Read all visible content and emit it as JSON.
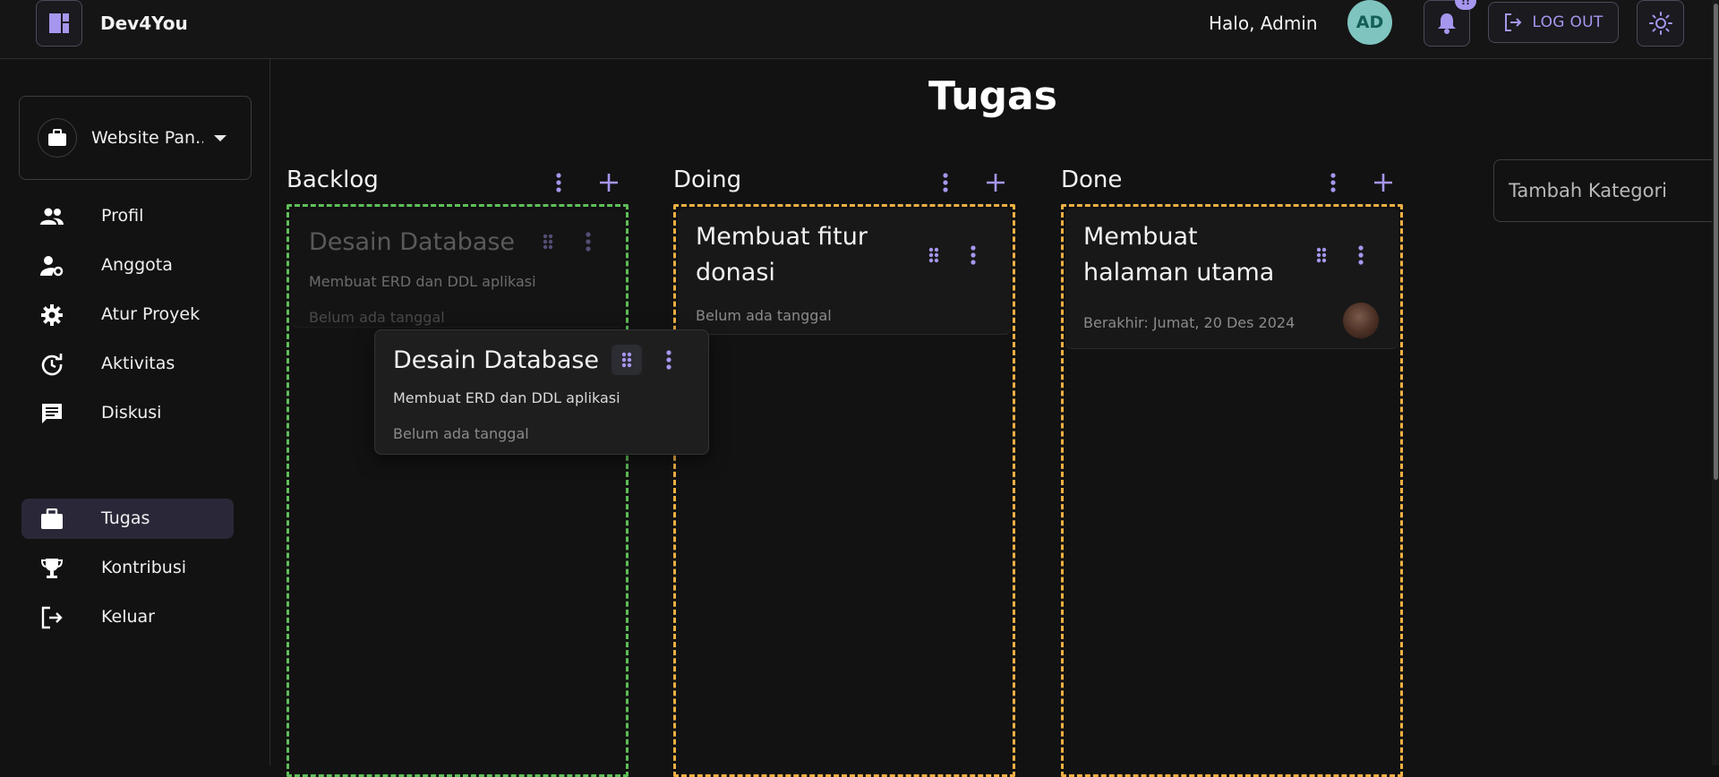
{
  "header": {
    "brand": "Dev4You",
    "greeting": "Halo, Admin",
    "avatar_initials": "AD",
    "notification_count": "!!",
    "logout_label": "LOG OUT"
  },
  "sidebar": {
    "project_name": "Website Pan...",
    "items": [
      {
        "label": "Profil",
        "icon": "people-icon"
      },
      {
        "label": "Anggota",
        "icon": "member-settings-icon"
      },
      {
        "label": "Atur Proyek",
        "icon": "gear-icon"
      },
      {
        "label": "Aktivitas",
        "icon": "history-icon"
      },
      {
        "label": "Diskusi",
        "icon": "chat-icon"
      },
      {
        "label": "Tugas",
        "icon": "briefcase-icon",
        "active": true
      },
      {
        "label": "Kontribusi",
        "icon": "trophy-icon"
      },
      {
        "label": "Keluar",
        "icon": "logout-icon"
      }
    ]
  },
  "main": {
    "title": "Tugas",
    "add_category_placeholder": "Tambah Kategori",
    "columns": [
      {
        "title": "Backlog",
        "border_color": "#5fbe58",
        "cards": [
          {
            "title": "Desain Database",
            "description": "Membuat ERD dan DDL aplikasi",
            "date": "Belum ada tanggal",
            "state": "placeholder"
          }
        ]
      },
      {
        "title": "Doing",
        "border_color": "#f2b043",
        "cards": [
          {
            "title_line1": "Membuat fitur",
            "title_line2": "donasi",
            "date": "Belum ada tanggal"
          }
        ]
      },
      {
        "title": "Done",
        "border_color": "#f2b043",
        "cards": [
          {
            "title_line1": "Membuat",
            "title_line2": "halaman utama",
            "date": "Berakhir: Jumat, 20 Des 2024",
            "has_assignee": true
          }
        ]
      }
    ],
    "dragging_card": {
      "title": "Desain Database",
      "description": "Membuat ERD dan DDL aplikasi",
      "date": "Belum ada tanggal"
    }
  },
  "colors": {
    "accent": "#a796ee",
    "background": "#121212",
    "backlog": "#5fbe58",
    "doing_done": "#f2b043"
  }
}
